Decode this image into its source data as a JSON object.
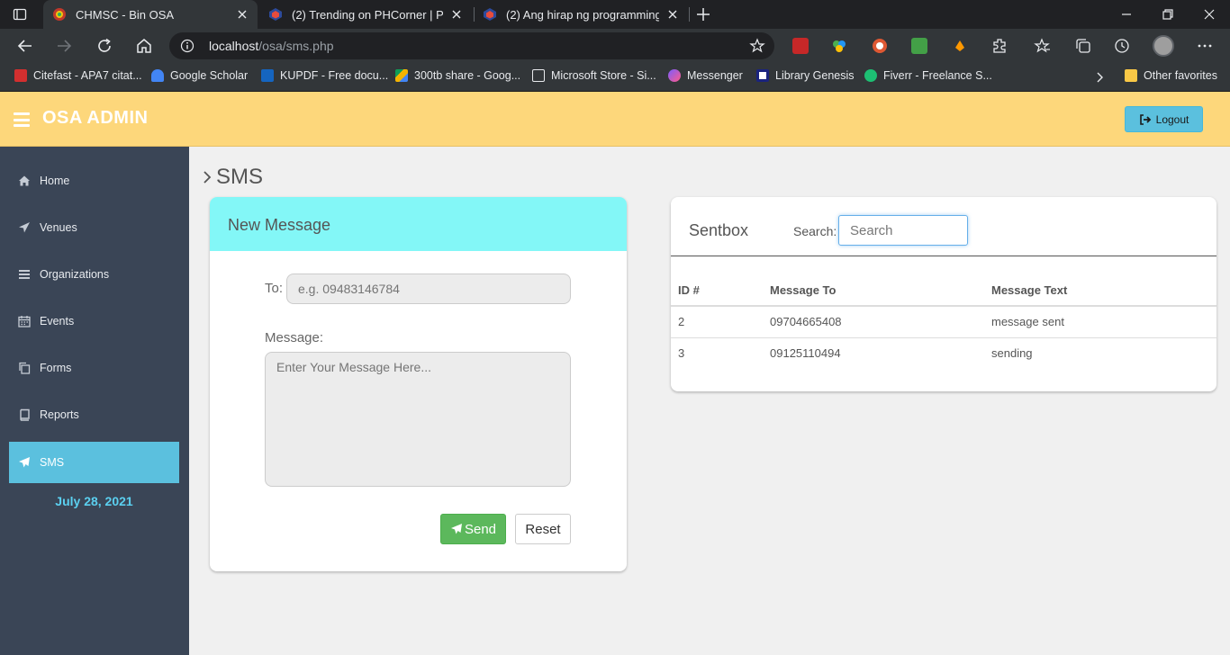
{
  "browser": {
    "tabs": [
      {
        "title": "CHMSC - Bin OSA",
        "active": true
      },
      {
        "title": "(2) Trending on PHCorner | Pinoy",
        "active": false
      },
      {
        "title": "(2) Ang hirap ng programming |",
        "active": false
      }
    ],
    "url_host": "localhost",
    "url_path": "/osa/sms.php",
    "bookmarks": [
      "Citefast - APA7 citat...",
      "Google Scholar",
      "KUPDF - Free docu...",
      "300tb share - Goog...",
      "Microsoft Store - Si...",
      "Messenger",
      "Library Genesis",
      "Fiverr - Freelance S...",
      "Other favorites"
    ]
  },
  "header": {
    "brand": "OSA ADMIN",
    "logout_label": "Logout"
  },
  "sidebar": {
    "items": [
      {
        "label": "Home",
        "icon": "home-icon"
      },
      {
        "label": "Venues",
        "icon": "send-icon"
      },
      {
        "label": "Organizations",
        "icon": "list-icon"
      },
      {
        "label": "Events",
        "icon": "calendar-icon"
      },
      {
        "label": "Forms",
        "icon": "copy-icon"
      },
      {
        "label": "Reports",
        "icon": "book-icon"
      },
      {
        "label": "SMS",
        "icon": "send-icon",
        "active": true
      }
    ],
    "date": "July 28, 2021"
  },
  "main": {
    "title": "SMS",
    "new_message": {
      "heading": "New Message",
      "to_label": "To:",
      "to_placeholder": "e.g. 09483146784",
      "message_label": "Message:",
      "message_placeholder": "Enter Your Message Here...",
      "send_label": "Send",
      "reset_label": "Reset"
    },
    "sentbox": {
      "heading": "Sentbox",
      "search_label": "Search:",
      "search_placeholder": "Search",
      "columns": [
        "ID #",
        "Message To",
        "Message Text"
      ],
      "rows": [
        [
          "2",
          "09704665408",
          "message sent"
        ],
        [
          "3",
          "09125110494",
          "sending"
        ]
      ]
    }
  },
  "colors": {
    "header_bg": "#fdd77b",
    "sidebar_bg": "#3a4556",
    "accent": "#5bc0de",
    "new_message_head": "#83f7f7",
    "send_button": "#5cb85c"
  }
}
